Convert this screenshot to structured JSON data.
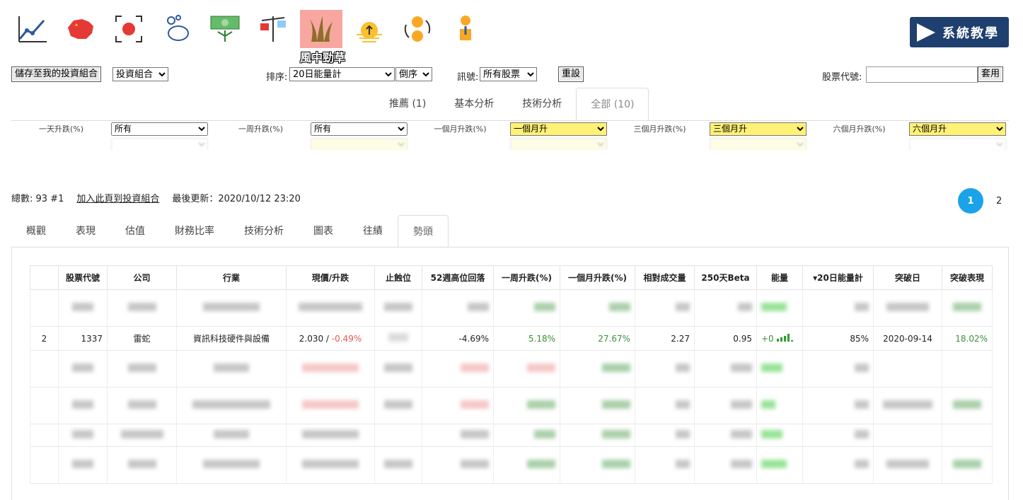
{
  "toolbar": {
    "icons": [
      "line-chart-icon",
      "china-map-icon",
      "target-record-icon",
      "piggy-bank-icon",
      "money-growth-icon",
      "scale-icon",
      "grass-icon",
      "sunrise-icon",
      "coin-exchange-icon",
      "coin-growth-icon"
    ],
    "active_label": "風中勁草",
    "teach_label": "系統教學"
  },
  "controls": {
    "save_button": "儲存至我的投資組合",
    "portfolio_select": "投資組合",
    "sort_label": "排序:",
    "sort_select": "20日能量計",
    "order_select": "倒序",
    "signal_label": "訊號:",
    "signal_select": "所有股票",
    "reset_button": "重設",
    "stock_code_label": "股票代號:",
    "stock_code_placeholder": "",
    "apply_button": "套用"
  },
  "filter_tabs": [
    "推薦 (1)",
    "基本分析",
    "技術分析",
    "全部 (10)"
  ],
  "filters": [
    {
      "label": "一天升跌(%)",
      "value": "所有",
      "highlight": false
    },
    {
      "label": "一周升跌(%)",
      "value": "所有",
      "highlight": false
    },
    {
      "label": "一個月升跌(%)",
      "value": "一個月升",
      "highlight": true
    },
    {
      "label": "三個月升跌(%)",
      "value": "三個月升",
      "highlight": true
    },
    {
      "label": "六個月升跌(%)",
      "value": "六個月升",
      "highlight": true
    }
  ],
  "summary": {
    "count": "總數: 93 #1",
    "add_link": "加入此頁到投資組合",
    "updated": "最後更新：2020/10/12 23:20"
  },
  "pages": [
    "1",
    "2"
  ],
  "tabs": [
    "概觀",
    "表現",
    "估值",
    "財務比率",
    "技術分析",
    "圖表",
    "往績",
    "勢頭"
  ],
  "table": {
    "headers": [
      "",
      "股票代號",
      "公司",
      "行業",
      "現價/升跌",
      "止蝕位",
      "52週高位回落",
      "一周升跌(%)",
      "一個月升跌(%)",
      "相對成交量",
      "250天Beta",
      "能量",
      "▾20日能量計",
      "突破日",
      "突破表現"
    ],
    "row": {
      "idx": "2",
      "code": "1337",
      "company": "雷蛇",
      "industry": "資訊科技硬件與設備",
      "price": "2.030",
      "sep": " / ",
      "change": "-0.49%",
      "stop": "",
      "drawdown": "-4.69%",
      "week": "5.18%",
      "month": "27.67%",
      "relvol": "2.27",
      "beta": "0.95",
      "energy": "+0",
      "energy20": "85%",
      "break_date": "2020-09-14",
      "break_perf": "18.02%"
    }
  }
}
